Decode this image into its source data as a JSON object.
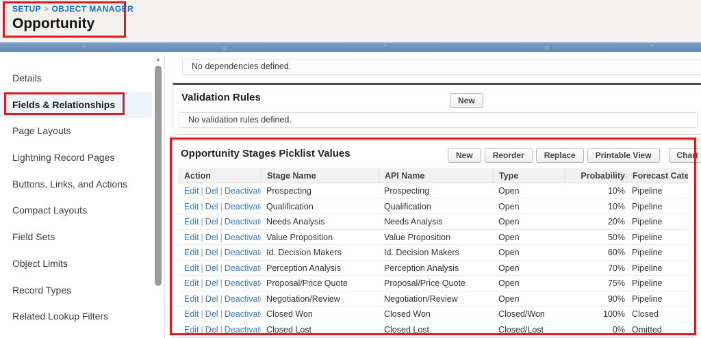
{
  "colors": {
    "annotation_red": "#e0191e",
    "link_blue": "#3d7cb8",
    "breadcrumb_blue": "#0e70c0",
    "band_blue": "#6b93be",
    "selected_item_bg": "#eef4fb",
    "section_top_border": "#49505b"
  },
  "icons": {
    "scroll_up_arrow": "▲",
    "dropdown_arrow": "▼"
  },
  "header": {
    "breadcrumb": {
      "setup": "SETUP",
      "separator": ">",
      "object_manager": "OBJECT MANAGER"
    },
    "title": "Opportunity"
  },
  "sidebar": {
    "items": [
      {
        "label": "Details",
        "selected": false
      },
      {
        "label": "Fields & Relationships",
        "selected": true
      },
      {
        "label": "Page Layouts",
        "selected": false
      },
      {
        "label": "Lightning Record Pages",
        "selected": false
      },
      {
        "label": "Buttons, Links, and Actions",
        "selected": false
      },
      {
        "label": "Compact Layouts",
        "selected": false
      },
      {
        "label": "Field Sets",
        "selected": false
      },
      {
        "label": "Object Limits",
        "selected": false
      },
      {
        "label": "Record Types",
        "selected": false
      },
      {
        "label": "Related Lookup Filters",
        "selected": false
      }
    ]
  },
  "main": {
    "dependencies_note": "No dependencies defined.",
    "validation_rules": {
      "title": "Validation Rules",
      "new_button": "New",
      "empty_note": "No validation rules defined."
    },
    "picklist_section": {
      "title": "Opportunity Stages Picklist Values",
      "buttons": [
        {
          "label": "New"
        },
        {
          "label": "Reorder"
        },
        {
          "label": "Replace"
        },
        {
          "label": "Printable View"
        }
      ],
      "chart_colors_button": {
        "label": "Chart Colors"
      },
      "table": {
        "columns": [
          "Action",
          "Stage Name",
          "API Name",
          "Type",
          "Probability",
          "Forecast Category"
        ],
        "action_links": [
          "Edit",
          "Del",
          "Deactivate"
        ],
        "rows": [
          {
            "stage_name": "Prospecting",
            "api_name": "Prospecting",
            "type": "Open",
            "probability": "10%",
            "forecast_category": "Pipeline"
          },
          {
            "stage_name": "Qualification",
            "api_name": "Qualification",
            "type": "Open",
            "probability": "10%",
            "forecast_category": "Pipeline"
          },
          {
            "stage_name": "Needs Analysis",
            "api_name": "Needs Analysis",
            "type": "Open",
            "probability": "20%",
            "forecast_category": "Pipeline"
          },
          {
            "stage_name": "Value Proposition",
            "api_name": "Value Proposition",
            "type": "Open",
            "probability": "50%",
            "forecast_category": "Pipeline"
          },
          {
            "stage_name": "Id. Decision Makers",
            "api_name": "Id. Decision Makers",
            "type": "Open",
            "probability": "60%",
            "forecast_category": "Pipeline"
          },
          {
            "stage_name": "Perception Analysis",
            "api_name": "Perception Analysis",
            "type": "Open",
            "probability": "70%",
            "forecast_category": "Pipeline"
          },
          {
            "stage_name": "Proposal/Price Quote",
            "api_name": "Proposal/Price Quote",
            "type": "Open",
            "probability": "75%",
            "forecast_category": "Pipeline"
          },
          {
            "stage_name": "Negotiation/Review",
            "api_name": "Negotiation/Review",
            "type": "Open",
            "probability": "90%",
            "forecast_category": "Pipeline"
          },
          {
            "stage_name": "Closed Won",
            "api_name": "Closed Won",
            "type": "Closed/Won",
            "probability": "100%",
            "forecast_category": "Closed"
          },
          {
            "stage_name": "Closed Lost",
            "api_name": "Closed Lost",
            "type": "Closed/Lost",
            "probability": "0%",
            "forecast_category": "Omitted"
          }
        ]
      }
    }
  }
}
